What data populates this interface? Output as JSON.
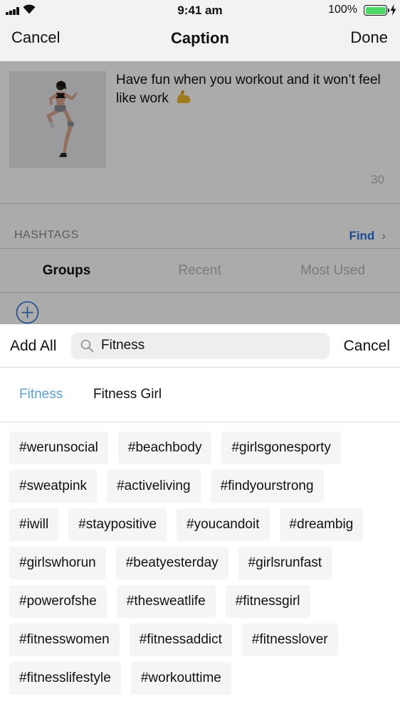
{
  "status_bar": {
    "time": "9:41 am",
    "battery_pct": "100%",
    "battery_level": 1.0,
    "battery_color": "#4cd964",
    "icons": [
      "signal-icon",
      "wifi-icon",
      "battery-icon",
      "charging-bolt-icon"
    ]
  },
  "nav": {
    "cancel": "Cancel",
    "title": "Caption",
    "done": "Done"
  },
  "post": {
    "caption": "Have fun when you workout and it won’t feel like work",
    "caption_emoji_icon": "flexed-biceps-icon",
    "char_count": "30"
  },
  "hashtags": {
    "label": "HASHTAGS",
    "find": "Find",
    "find_icon": "chevron-right-icon",
    "link_color": "#2d6fd6",
    "tabs": [
      {
        "label": "Groups",
        "active": true
      },
      {
        "label": "Recent",
        "active": false
      },
      {
        "label": "Most Used",
        "active": false
      }
    ],
    "add_icon": "plus-circle-icon"
  },
  "sheet": {
    "add_all": "Add All",
    "search": {
      "value": "Fitness",
      "placeholder": "Search",
      "icon": "search-icon"
    },
    "cancel": "Cancel",
    "groups": [
      {
        "label": "Fitness",
        "active": true
      },
      {
        "label": "Fitness Girl",
        "active": false
      }
    ],
    "active_group_color": "#5b9fd0",
    "tag_rows": [
      [
        "#werunsocial",
        "#beachbody",
        "#girlsgonesporty"
      ],
      [
        "#sweatpink",
        "#activeliving",
        "#findyourstrong"
      ],
      [
        "#iwill",
        "#staypositive",
        "#youcandoit",
        "#dreambig"
      ],
      [
        "#girlswhorun",
        "#beatyesterday",
        "#girlsrunfast"
      ],
      [
        "#powerofshe",
        "#thesweatlife",
        "#fitnessgirl"
      ],
      [
        "#fitnesswomen",
        "#fitnessaddict",
        "#fitnesslover"
      ],
      [
        "#fitnesslifestyle",
        "#workouttime"
      ]
    ]
  }
}
